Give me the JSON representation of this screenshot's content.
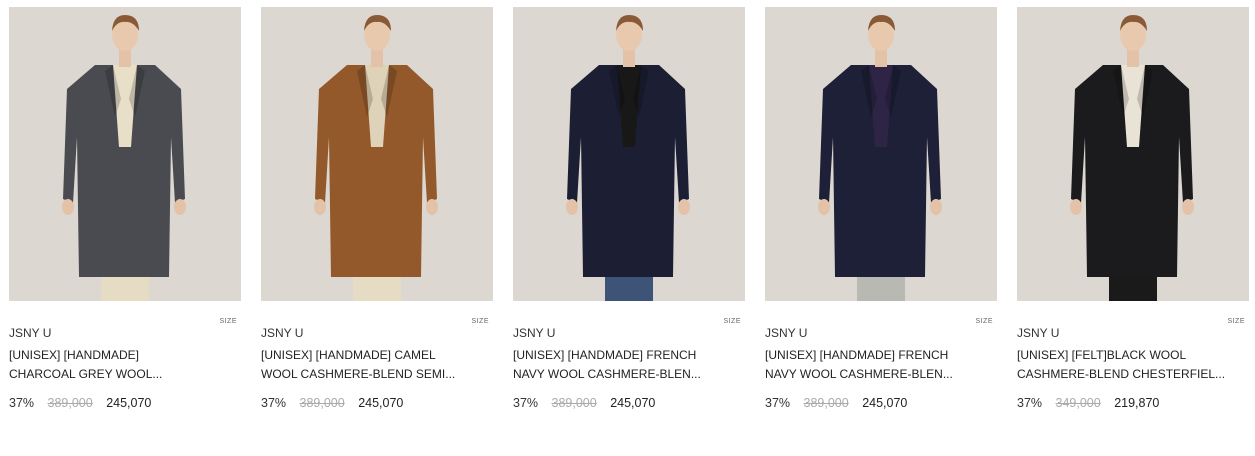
{
  "colors": {
    "background": "#ffffff",
    "photo_background": "#dcd7d1",
    "strike_price": "#aaaaaa"
  },
  "products": [
    {
      "brand": "JSNY U",
      "name_line1": "[UNISEX] [HANDMADE]",
      "name_line2": "CHARCOAL GREY WOOL...",
      "size_tag": "SIZE",
      "discount": "37%",
      "original_price": "389,000",
      "sale_price": "245,070",
      "image": "model-charcoal-grey-coat",
      "coat_color": "#4a4b50",
      "inner_color": "#e8dfc9",
      "pants_color": "#e6dcc3"
    },
    {
      "brand": "JSNY U",
      "name_line1": "[UNISEX] [HANDMADE] CAMEL",
      "name_line2": "WOOL CASHMERE-BLEND SEMI...",
      "size_tag": "SIZE",
      "discount": "37%",
      "original_price": "389,000",
      "sale_price": "245,070",
      "image": "model-camel-coat",
      "coat_color": "#93592a",
      "inner_color": "#ded2b8",
      "pants_color": "#e6dcc3"
    },
    {
      "brand": "JSNY U",
      "name_line1": "[UNISEX] [HANDMADE] FRENCH",
      "name_line2": "NAVY WOOL CASHMERE-BLEN...",
      "size_tag": "SIZE",
      "discount": "37%",
      "original_price": "389,000",
      "sale_price": "245,070",
      "image": "model-french-navy-coat",
      "coat_color": "#1c1f33",
      "inner_color": "#181818",
      "pants_color": "#3d5478"
    },
    {
      "brand": "JSNY U",
      "name_line1": "[UNISEX] [HANDMADE] FRENCH",
      "name_line2": "NAVY WOOL CASHMERE-BLEN...",
      "size_tag": "SIZE",
      "discount": "37%",
      "original_price": "389,000",
      "sale_price": "245,070",
      "image": "model-french-navy-coat-sweatshirt",
      "coat_color": "#1d2036",
      "inner_color": "#2e2446",
      "pants_color": "#b9b9b4"
    },
    {
      "brand": "JSNY U",
      "name_line1": "[UNISEX] [FELT]BLACK WOOL",
      "name_line2": "CASHMERE-BLEND CHESTERFIEL...",
      "size_tag": "SIZE",
      "discount": "37%",
      "original_price": "349,000",
      "sale_price": "219,870",
      "image": "model-black-chesterfield-coat",
      "coat_color": "#1b1b1d",
      "inner_color": "#e9e3d6",
      "pants_color": "#1a1a1a"
    }
  ]
}
